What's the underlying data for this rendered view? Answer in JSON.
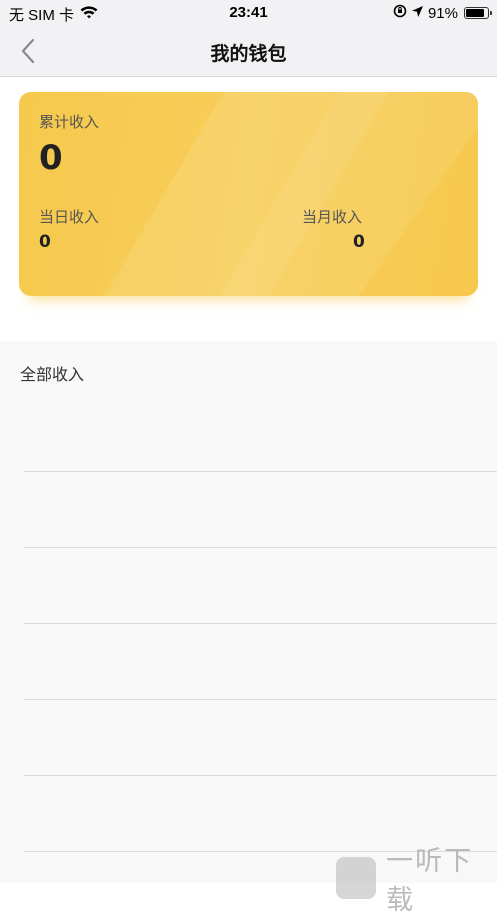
{
  "status_bar": {
    "carrier": "无 SIM 卡",
    "time": "23:41",
    "battery_percent": "91%",
    "battery_level": 0.91,
    "icons": [
      "wifi-icon",
      "orientation-lock-icon",
      "location-arrow-icon",
      "battery-icon"
    ]
  },
  "nav": {
    "title": "我的钱包",
    "back_icon": "chevron-left-icon"
  },
  "wallet": {
    "total_label": "累计收入",
    "total_value": "0",
    "today_label": "当日收入",
    "today_value": "0",
    "month_label": "当月收入",
    "month_value": "0",
    "card_color": "#f7ca50"
  },
  "income": {
    "title": "全部收入",
    "rows": [
      "",
      "",
      "",
      "",
      "",
      ""
    ]
  },
  "watermark": {
    "text": "一听下载"
  }
}
